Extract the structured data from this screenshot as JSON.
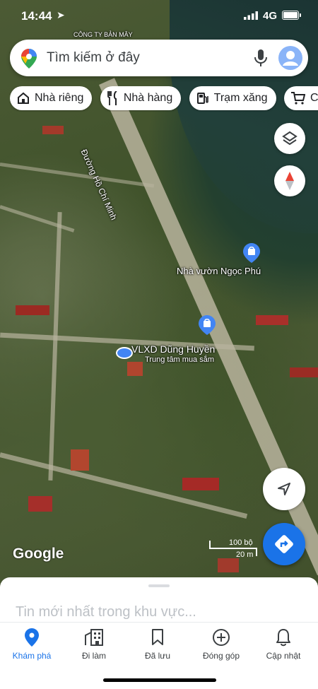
{
  "status_bar": {
    "time": "14:44",
    "network": "4G"
  },
  "search": {
    "placeholder": "Tìm kiếm ở đây"
  },
  "chips": [
    {
      "label": "Nhà riêng",
      "icon": "home-icon"
    },
    {
      "label": "Nhà hàng",
      "icon": "restaurant-icon"
    },
    {
      "label": "Trạm xăng",
      "icon": "gas-station-icon"
    },
    {
      "label": "Cửa",
      "icon": "shopping-cart-icon"
    }
  ],
  "map": {
    "top_label": "CÔNG TY BẢN MÂY",
    "road_name": "Đường Hồ Chí Minh",
    "poi_1": {
      "name": "Nhà vườn Ngọc Phú"
    },
    "poi_2": {
      "name": "VLXD Dũng Huyền",
      "sub": "Trung tâm mua sắm"
    },
    "logo": "Google",
    "scale_top": "100 bộ",
    "scale_bottom": "20 m"
  },
  "sheet": {
    "title": "Tin mới nhất trong khu vực..."
  },
  "nav": [
    {
      "label": "Khám phá",
      "icon": "explore-pin-icon",
      "active": true
    },
    {
      "label": "Đi làm",
      "icon": "commute-icon",
      "active": false
    },
    {
      "label": "Đã lưu",
      "icon": "bookmark-icon",
      "active": false
    },
    {
      "label": "Đóng góp",
      "icon": "add-circle-icon",
      "active": false
    },
    {
      "label": "Cập nhật",
      "icon": "bell-icon",
      "active": false
    }
  ],
  "colors": {
    "accent": "#1a73e8",
    "poi_pin": "#4285f4"
  }
}
